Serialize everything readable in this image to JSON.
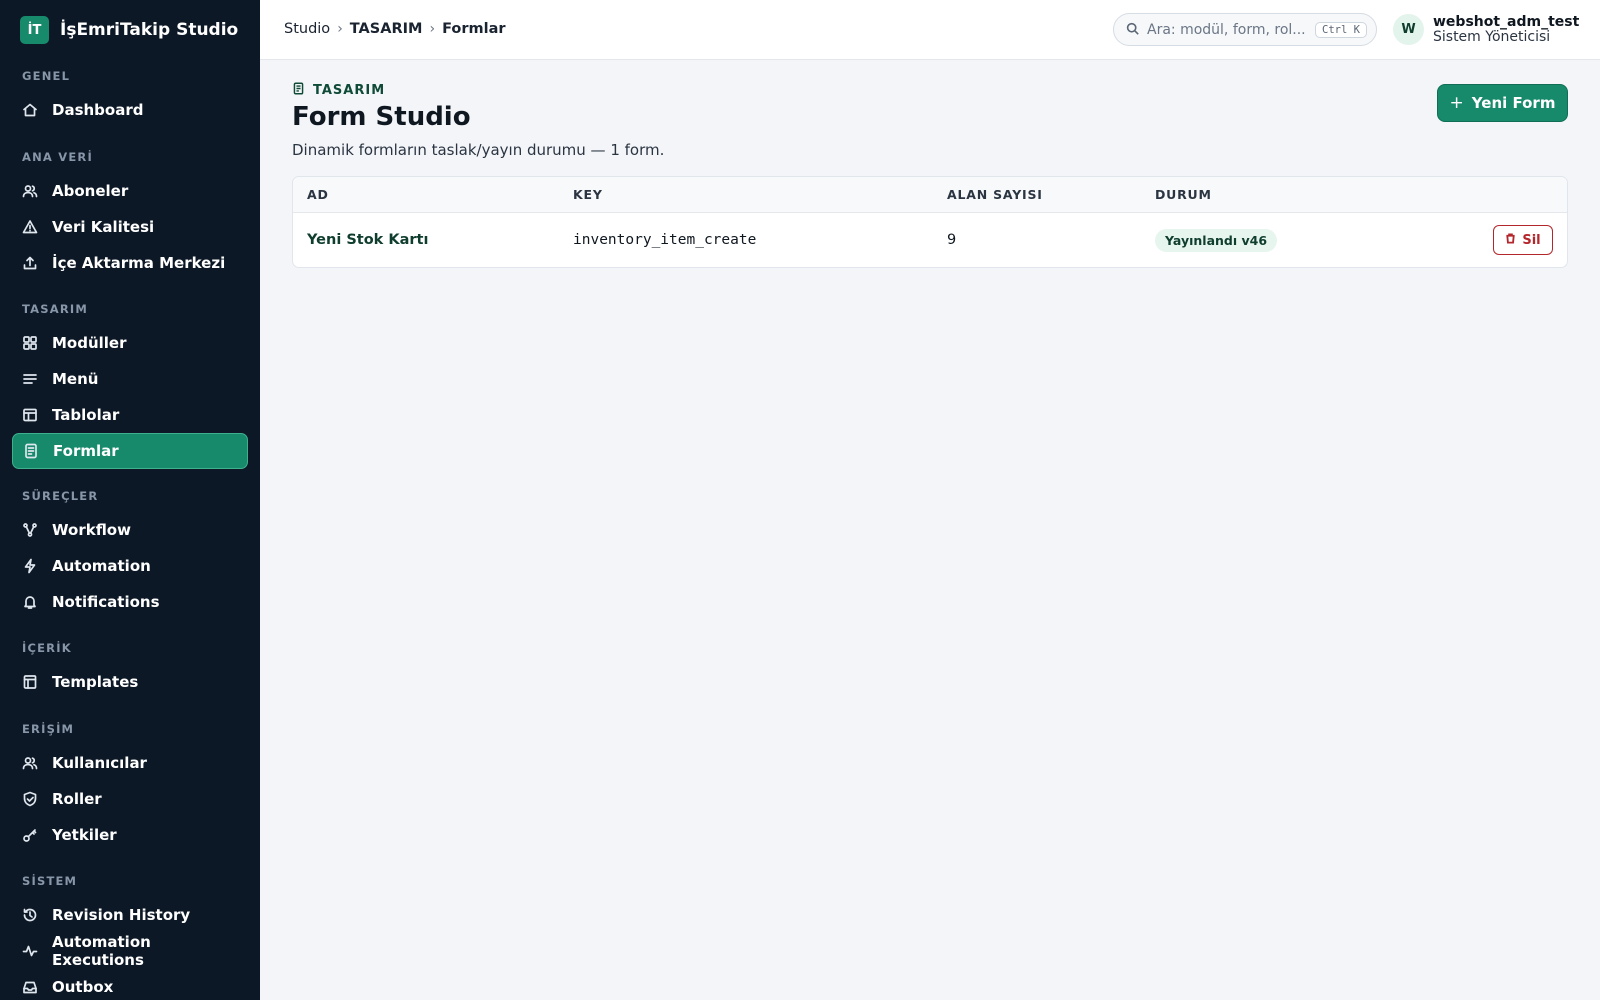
{
  "brand": {
    "logo_text": "İT",
    "name": "İşEmriTakip Studio"
  },
  "sidebar": {
    "sections": [
      {
        "heading": "GENEL",
        "items": [
          {
            "label": "Dashboard",
            "icon": "home-icon"
          }
        ]
      },
      {
        "heading": "ANA VERİ",
        "items": [
          {
            "label": "Aboneler",
            "icon": "users-icon"
          },
          {
            "label": "Veri Kalitesi",
            "icon": "warning-icon"
          },
          {
            "label": "İçe Aktarma Merkezi",
            "icon": "upload-icon"
          }
        ]
      },
      {
        "heading": "TASARIM",
        "items": [
          {
            "label": "Modüller",
            "icon": "grid-icon"
          },
          {
            "label": "Menü",
            "icon": "menu-icon"
          },
          {
            "label": "Tablolar",
            "icon": "table-icon"
          },
          {
            "label": "Formlar",
            "icon": "form-icon",
            "active": true
          }
        ]
      },
      {
        "heading": "SÜREÇLER",
        "items": [
          {
            "label": "Workflow",
            "icon": "workflow-icon"
          },
          {
            "label": "Automation",
            "icon": "bolt-icon"
          },
          {
            "label": "Notifications",
            "icon": "bell-icon"
          }
        ]
      },
      {
        "heading": "İÇERİK",
        "items": [
          {
            "label": "Templates",
            "icon": "template-icon"
          }
        ]
      },
      {
        "heading": "ERİŞİM",
        "items": [
          {
            "label": "Kullanıcılar",
            "icon": "users-icon"
          },
          {
            "label": "Roller",
            "icon": "shield-icon"
          },
          {
            "label": "Yetkiler",
            "icon": "key-icon"
          }
        ]
      },
      {
        "heading": "SİSTEM",
        "items": [
          {
            "label": "Revision History",
            "icon": "history-icon"
          },
          {
            "label": "Automation Executions",
            "icon": "activity-icon"
          },
          {
            "label": "Outbox",
            "icon": "outbox-icon"
          }
        ]
      }
    ]
  },
  "topbar": {
    "breadcrumb": [
      "Studio",
      "TASARIM",
      "Formlar"
    ],
    "search": {
      "placeholder": "Ara: modül, form, rol...",
      "shortcut": "Ctrl K"
    },
    "user": {
      "initial": "W",
      "name": "webshot_adm_test",
      "role": "Sistem Yöneticisi"
    }
  },
  "page": {
    "eyebrow": "TASARIM",
    "title": "Form Studio",
    "description": "Dinamik formların taslak/yayın durumu — 1 form.",
    "new_button": "Yeni Form"
  },
  "table": {
    "columns": [
      "AD",
      "KEY",
      "ALAN SAYISI",
      "DURUM"
    ],
    "rows": [
      {
        "name": "Yeni Stok Kartı",
        "key": "inventory_item_create",
        "field_count": "9",
        "status": "Yayınlandı v46",
        "action": "Sil"
      }
    ]
  },
  "colors": {
    "accent": "#178a6c",
    "sidebar_bg": "#0d1826",
    "danger": "#b3262b"
  }
}
